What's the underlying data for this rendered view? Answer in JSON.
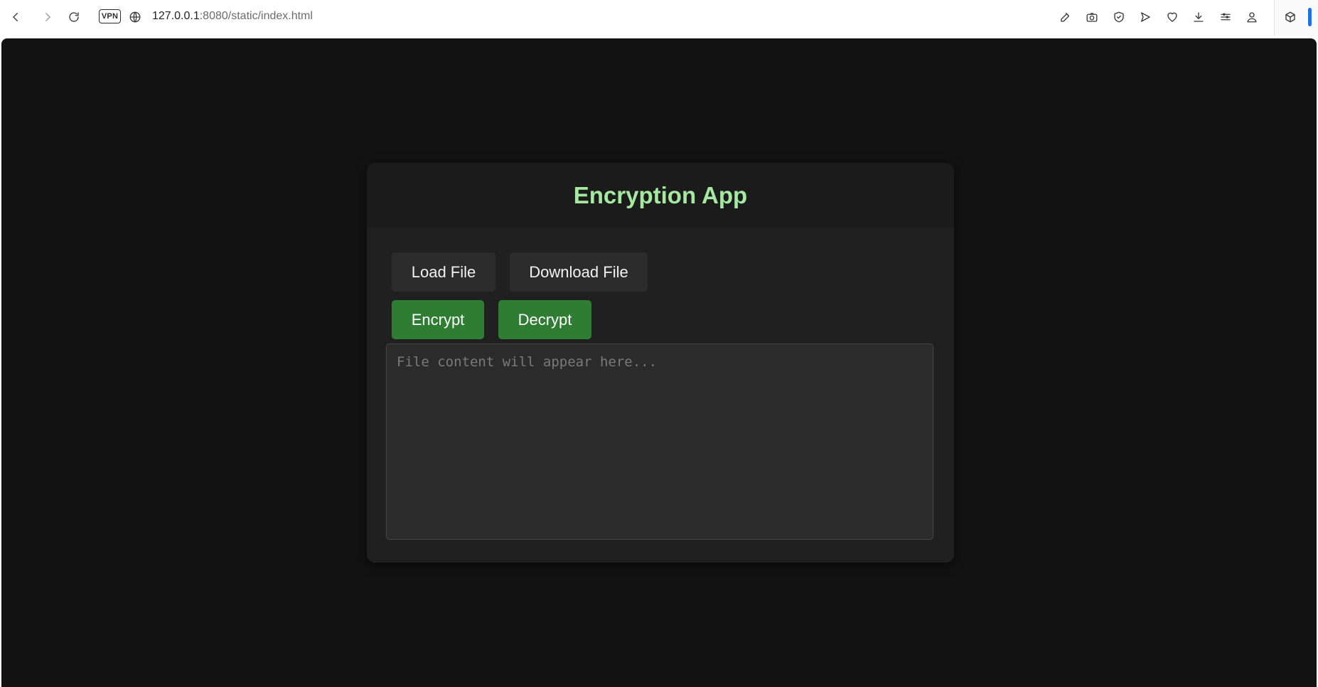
{
  "browser": {
    "vpn_label": "VPN",
    "url_host": "127.0.0.1",
    "url_rest": ":8080/static/index.html",
    "icons": [
      "back-icon",
      "forward-icon",
      "reload-icon",
      "globe-icon",
      "edit-icon",
      "camera-icon",
      "shield-icon",
      "send-icon",
      "heart-icon",
      "download-icon",
      "menu-icon",
      "profile-icon",
      "box-icon"
    ]
  },
  "app": {
    "title": "Encryption App",
    "buttons": {
      "load": "Load File",
      "download": "Download File",
      "encrypt": "Encrypt",
      "decrypt": "Decrypt"
    },
    "content": {
      "value": "",
      "placeholder": "File content will appear here..."
    },
    "colors": {
      "background": "#121212",
      "card": "#1e1e1e",
      "title": "#a5e8a0",
      "accent_green": "#2e7d32",
      "button_gray": "#2c2c2c"
    }
  }
}
